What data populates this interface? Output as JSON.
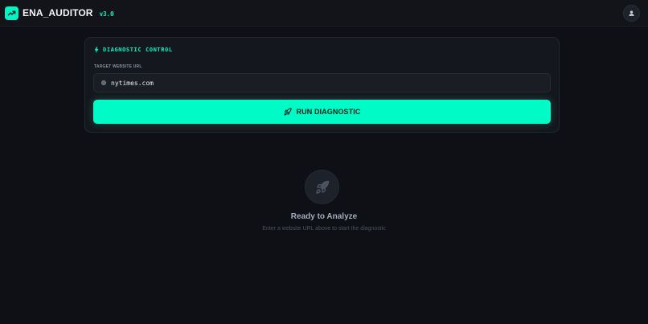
{
  "app": {
    "name": "ENA_AUDITOR",
    "version": "v3.0",
    "logo_icon": "trending-up-icon",
    "user_icon": "user-icon"
  },
  "diagnostic": {
    "title": "DIAGNOSTIC CONTROL",
    "title_icon": "bolt-icon",
    "url_label": "TARGET WEBSITE URL",
    "url_value": "nytimes.com",
    "url_icon": "globe-icon",
    "run_label": "RUN DIAGNOSTIC",
    "run_icon": "rocket-icon"
  },
  "empty_state": {
    "icon": "rocket-icon",
    "title": "Ready to Analyze",
    "subtitle": "Enter a website URL above to start the diagnostic"
  },
  "colors": {
    "accent": "#00f5c4",
    "background": "#0e1015",
    "card": "#14171d"
  }
}
